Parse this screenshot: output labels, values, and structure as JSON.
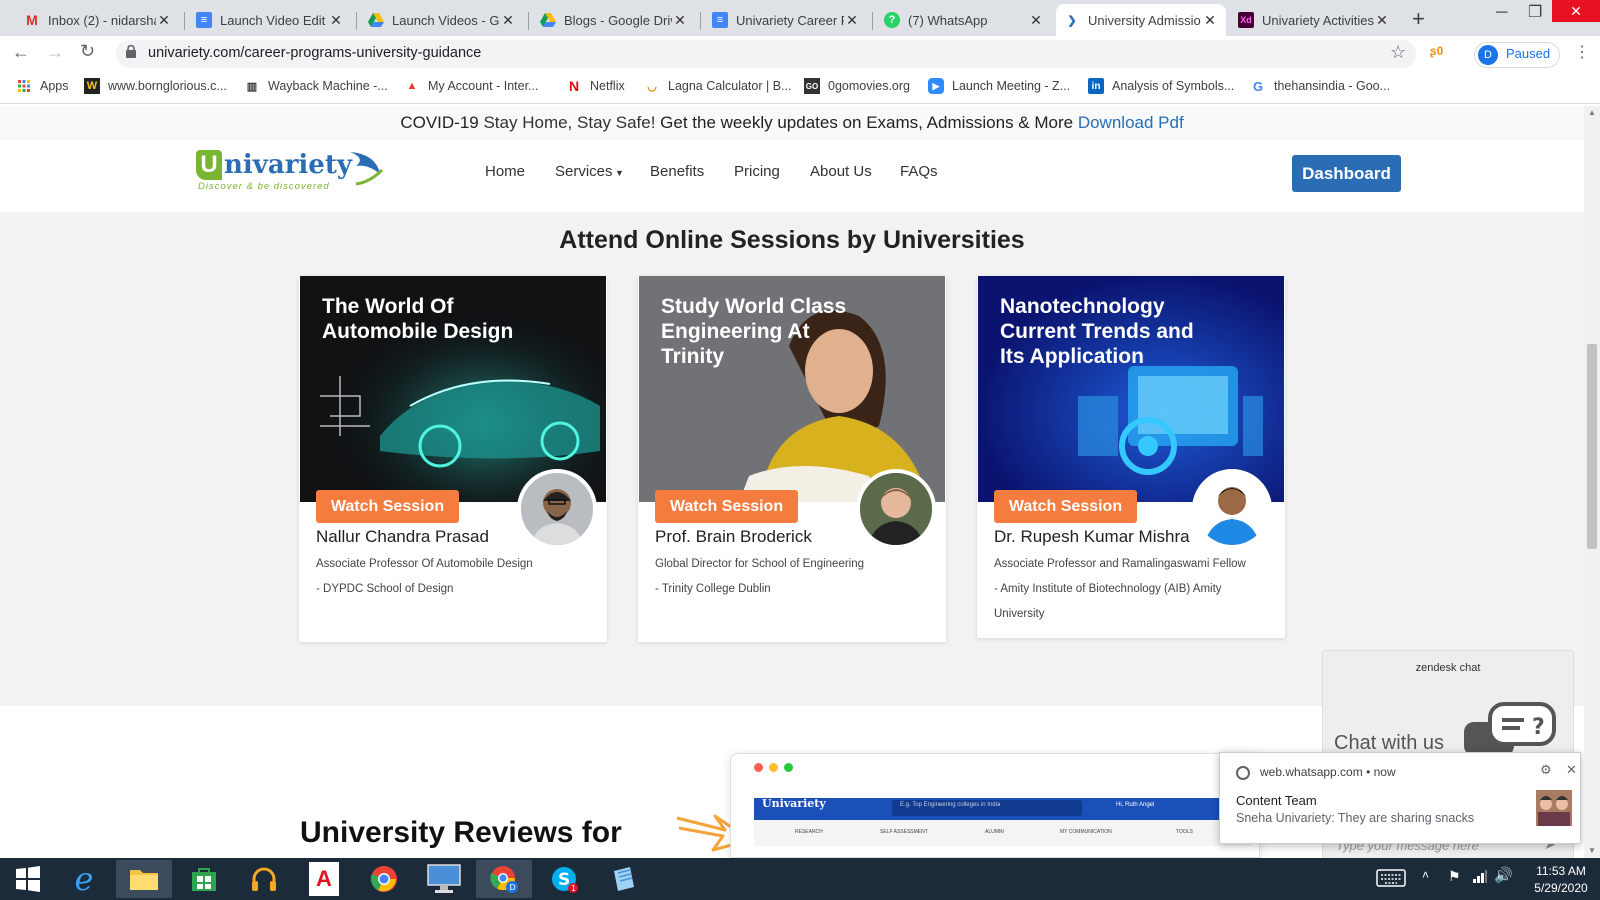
{
  "browser": {
    "tabs": [
      {
        "title": "Inbox (2) - nidarsha",
        "icon": "gmail-icon"
      },
      {
        "title": "Launch Video Edit T",
        "icon": "docs-icon"
      },
      {
        "title": "Launch Videos - Go",
        "icon": "drive-icon"
      },
      {
        "title": "Blogs - Google Driv",
        "icon": "drive-icon"
      },
      {
        "title": "Univariety Career P",
        "icon": "docs-icon"
      },
      {
        "title": "(7) WhatsApp",
        "icon": "whatsapp-icon"
      },
      {
        "title": "University Admissio",
        "icon": "univariety-icon",
        "active": true
      },
      {
        "title": "Univariety Activities",
        "icon": "xd-icon"
      }
    ],
    "url": "univariety.com/career-programs-university-guidance",
    "profile_initial": "D",
    "profile_status": "Paused",
    "bookmarks": [
      {
        "label": "Apps",
        "icon": "apps-grid-icon"
      },
      {
        "label": "www.bornglorious.c...",
        "icon": "bornglorious-icon"
      },
      {
        "label": "Wayback Machine -...",
        "icon": "wayback-icon"
      },
      {
        "label": "My Account - Inter...",
        "icon": "account-icon"
      },
      {
        "label": "Netflix",
        "icon": "netflix-icon"
      },
      {
        "label": "Lagna Calculator | B...",
        "icon": "lagna-icon"
      },
      {
        "label": "0gomovies.org",
        "icon": "gomovies-icon"
      },
      {
        "label": "Launch Meeting - Z...",
        "icon": "zoom-icon"
      },
      {
        "label": "Analysis of Symbols...",
        "icon": "linkedin-icon"
      },
      {
        "label": "thehansindia - Goo...",
        "icon": "google-icon"
      }
    ]
  },
  "banner": {
    "covid": "COVID-19",
    "stay": "Stay Home, Stay Safe!",
    "updates": "Get the weekly updates on Exams, Admissions & More",
    "link": "Download Pdf"
  },
  "nav": {
    "logo_text": "nivariety",
    "logo_letter": "U",
    "tagline": "Discover & be discovered",
    "links": [
      "Home",
      "Services",
      "Benefits",
      "Pricing",
      "About Us",
      "FAQs"
    ],
    "dashboard": "Dashboard"
  },
  "sessions": {
    "title": "Attend Online Sessions by Universities",
    "watch_label": "Watch Session",
    "cards": [
      {
        "title": "The World Of Automobile Design",
        "name": "Nallur Chandra Prasad",
        "role": "Associate Professor Of Automobile Design",
        "org": "- DYPDC School of Design"
      },
      {
        "title": "Study World Class Engineering At Trinity",
        "name": "Prof. Brain Broderick",
        "role": "Global Director for School of Engineering",
        "org": "- Trinity College Dublin"
      },
      {
        "title": "Nanotechnology Current Trends and Its Application",
        "name": "Dr. Rupesh Kumar Mishra",
        "role": "Associate Professor and Ramalingaswami Fellow",
        "org": "- Amity Institute of Biotechnology (AIB) Amity University"
      }
    ]
  },
  "reviews": {
    "title": "University Reviews for"
  },
  "mockup": {
    "search_placeholder": "E.g. Top Engineering colleges in India",
    "user": "Hi, Ruth Angel",
    "menu": [
      "RESEARCH",
      "SELF ASSESSMENT",
      "ALUMNI",
      "MY COMMUNICATION",
      "TOOLS"
    ]
  },
  "zendesk": {
    "brand": "zendesk chat",
    "chat": "Chat with us",
    "placeholder": "Type your message here"
  },
  "notification": {
    "source": "web.whatsapp.com",
    "time": "now",
    "title": "Content Team",
    "body": "Sneha Univariety: They are sharing snacks"
  },
  "taskbar": {
    "time": "11:53 AM",
    "date": "5/29/2020"
  }
}
